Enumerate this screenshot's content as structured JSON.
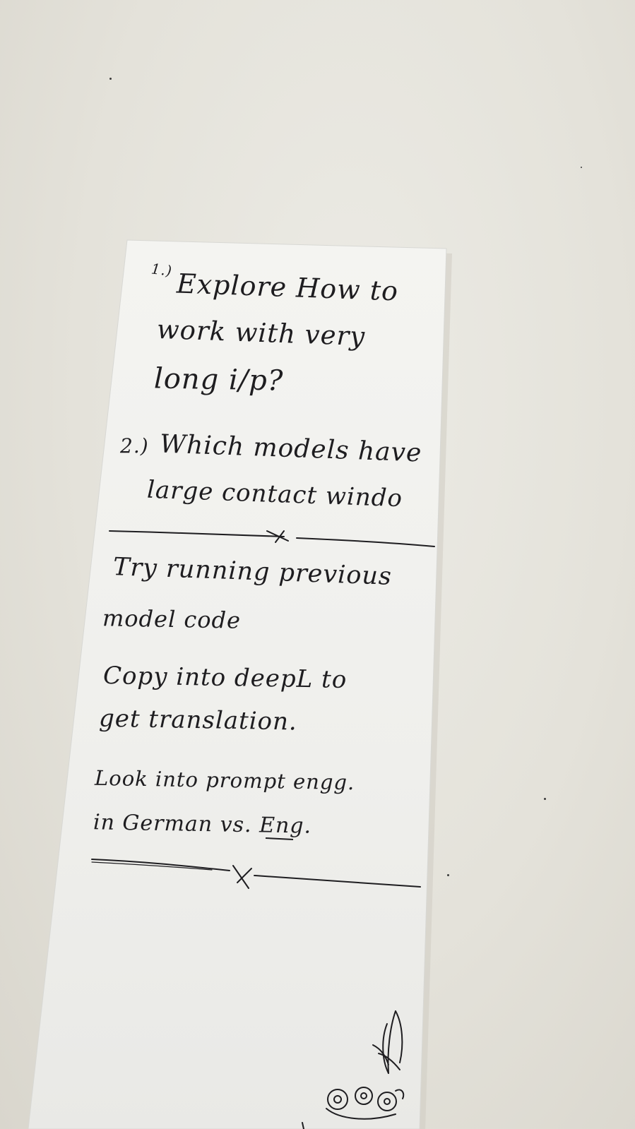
{
  "photo": {
    "subject": "handwritten-note-slip",
    "table_color": "#e6e4dd",
    "paper_color": "#f2f2ef",
    "ink_color": "#1e1d20"
  },
  "note": {
    "item1": {
      "number": "1.)",
      "lines": [
        "Explore How to",
        "work with very",
        "long i/p?"
      ]
    },
    "item2": {
      "number": "2.)",
      "lines": [
        "Which models have",
        "large contact windo"
      ]
    },
    "section2": {
      "lines": [
        "Try running previous",
        "model code",
        "Copy into deepL to",
        "get translation.",
        "Look into prompt engg.",
        "in German vs. Eng."
      ]
    },
    "doodle": "flower-doodle"
  }
}
